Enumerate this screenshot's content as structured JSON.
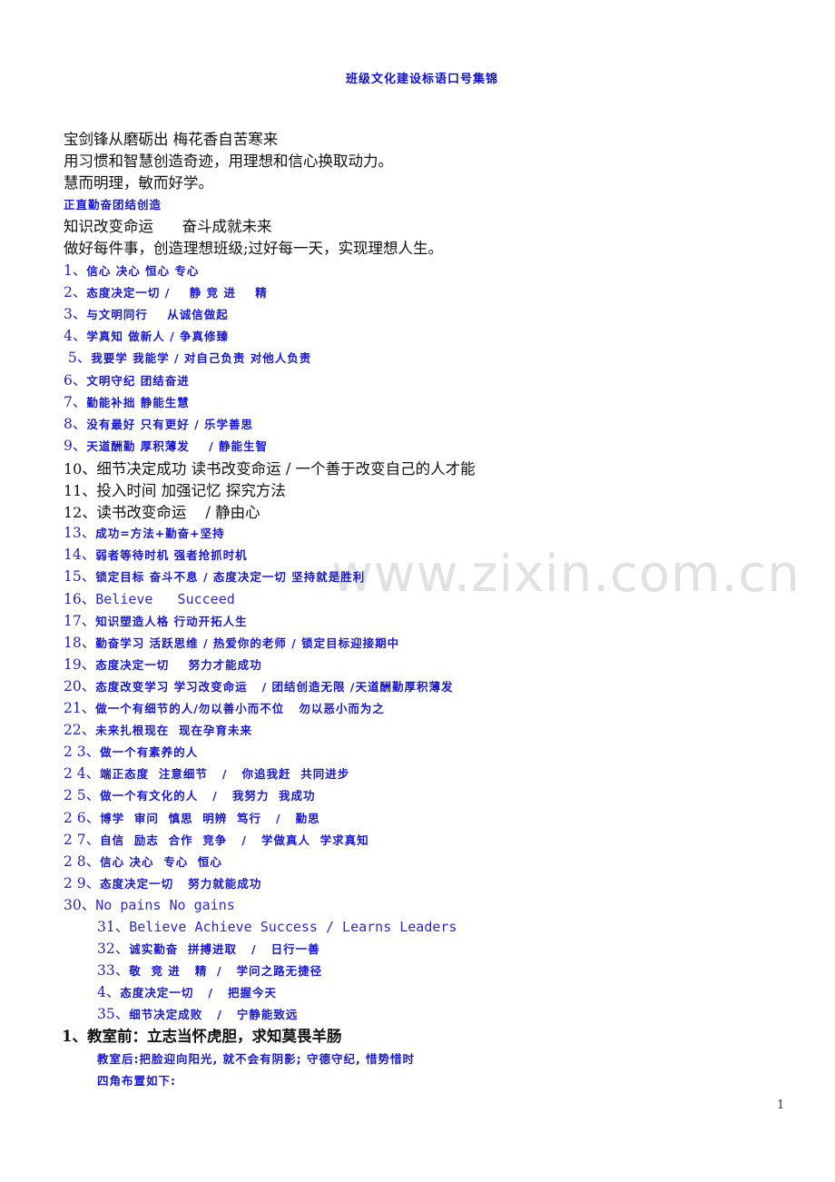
{
  "title": "班级文化建设标语口号集锦",
  "watermark": "www.zixin.com.cn",
  "intro_lines": [
    "宝剑锋从磨砺出 梅花香自苦寒来",
    "用习惯和智慧创造奇迹，用理想和信心换取动力。",
    "慧而明理，敏而好学。"
  ],
  "blue_line": "正直勤奋团结创造",
  "intro_lines_2": [
    "知识改变命运      奋斗成就未来",
    "做好每件事，创造理想班级;过好每一天，实现理想人生。"
  ],
  "slogans": [
    {
      "num": "1、",
      "text": "信心 决心 恒心 专心"
    },
    {
      "num": "2、",
      "text": "态度决定一切 /    静 竞 进    精"
    },
    {
      "num": "3、",
      "text": "与文明同行    从诚信做起"
    },
    {
      "num": "4、",
      "text": "学真知 做新人 / 争真修臻"
    },
    {
      "num": " 5、",
      "text": "我要学 我能学 / 对自己负责 对他人负责"
    },
    {
      "num": "6、",
      "text": "文明守纪 团结奋进"
    },
    {
      "num": "7、",
      "text": "勤能补拙 静能生慧"
    },
    {
      "num": "8、",
      "text": "没有最好 只有更好 / 乐学善思"
    },
    {
      "num": "9、",
      "text": "天道酬勤 厚积薄发    / 静能生智"
    },
    {
      "num": "10、",
      "text": "细节决定成功 读书改变命运 / 一个善于改变自己的人才能"
    },
    {
      "num": "11、",
      "text": "投入时间 加强记忆 探究方法"
    },
    {
      "num": "12、",
      "text": "读书改变命运    / 静由心"
    },
    {
      "num": "13、",
      "text": "成功=方法+勤奋+坚持"
    },
    {
      "num": "14、",
      "text": "弱者等待时机 强者抢抓时机"
    },
    {
      "num": "15、",
      "text": "锁定目标 奋斗不息 / 态度决定一切 坚持就是胜利"
    },
    {
      "num": "16、",
      "text": "Believe   Succeed"
    },
    {
      "num": "17、",
      "text": "知识塑造人格 行动开拓人生"
    },
    {
      "num": "18、",
      "text": "勤奋学习 活跃思维 / 热爱你的老师 / 锁定目标迎接期中"
    },
    {
      "num": "19、",
      "text": "态度决定一切    努力才能成功"
    },
    {
      "num": "20、",
      "text": "态度改变学习 学习改变命运   / 团结创造无限 /天道酬勤厚积薄发"
    },
    {
      "num": "21、",
      "text": "做一个有细节的人/勿以善小而不位   勿以恶小而为之"
    },
    {
      "num": "22、",
      "text": "未来扎根现在  现在孕育未来"
    },
    {
      "num": "2 3、",
      "text": "做一个有素养的人"
    },
    {
      "num": "2 4、",
      "text": "端正态度  注意细节   /   你追我赶  共同进步"
    },
    {
      "num": "2 5、",
      "text": "做一个有文化的人   /   我努力  我成功"
    },
    {
      "num": "2 6、",
      "text": "博学  审问  慎思  明辨  笃行   /   勤思"
    },
    {
      "num": "2 7、",
      "text": "自信  励志  合作  竞争   /   学做真人  学求真知"
    },
    {
      "num": "2 8、",
      "text": "信心 决心  专心  恒心"
    },
    {
      "num": "2 9、",
      "text": "态度决定一切   努力就能成功"
    },
    {
      "num": "30、",
      "text": "No pains No gains"
    },
    {
      "num": "31、",
      "text": "Believe Achieve Success / Learns Leaders"
    },
    {
      "num": "32、",
      "text": "诚实勤奋  拼搏进取   /   日行一善"
    },
    {
      "num": "33、",
      "text": "敬  竞 进   精  /   学问之路无捷径"
    },
    {
      "num": "4、",
      "text": "态度决定一切   /   把握今天"
    },
    {
      "num": "35、",
      "text": "细节决定成败   /   宁静能致远"
    }
  ],
  "classroom_front": "1、教室前：立志当怀虎胆，求知莫畏羊肠",
  "classroom_back": "教室后:把脸迎向阳光, 就不会有阴影; 守德守纪, 惜势惜时",
  "corners": "四角布置如下:",
  "page_number": "1"
}
